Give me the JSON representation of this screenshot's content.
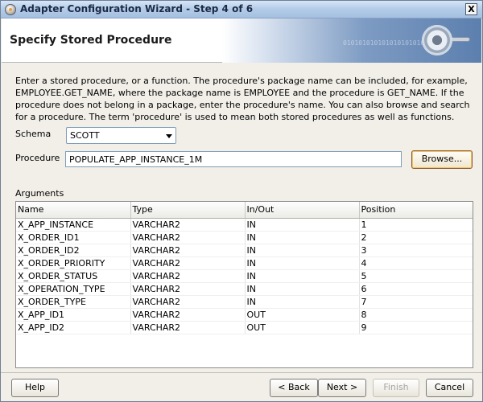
{
  "window": {
    "title": "Adapter Configuration Wizard - Step 4 of 6",
    "close_label": "X"
  },
  "header": {
    "title": "Specify Stored Procedure",
    "banner_bits": "010101010101010101010101"
  },
  "description": "Enter a stored procedure, or a function. The procedure's package name can be included, for example, EMPLOYEE.GET_NAME, where the package name is EMPLOYEE and the procedure is GET_NAME.  If the procedure does not belong in a package, enter the procedure's name. You can also browse and search for a procedure. The term 'procedure' is used to mean both stored procedures as well as functions.",
  "form": {
    "schema_label": "Schema",
    "schema_value": "SCOTT",
    "procedure_label": "Procedure",
    "procedure_value": "POPULATE_APP_INSTANCE_1M",
    "browse_label": "Browse..."
  },
  "arguments": {
    "label": "Arguments",
    "columns": [
      "Name",
      "Type",
      "In/Out",
      "Position"
    ],
    "rows": [
      [
        "X_APP_INSTANCE",
        "VARCHAR2",
        "IN",
        "1"
      ],
      [
        "X_ORDER_ID1",
        "VARCHAR2",
        "IN",
        "2"
      ],
      [
        "X_ORDER_ID2",
        "VARCHAR2",
        "IN",
        "3"
      ],
      [
        "X_ORDER_PRIORITY",
        "VARCHAR2",
        "IN",
        "4"
      ],
      [
        "X_ORDER_STATUS",
        "VARCHAR2",
        "IN",
        "5"
      ],
      [
        "X_OPERATION_TYPE",
        "VARCHAR2",
        "IN",
        "6"
      ],
      [
        "X_ORDER_TYPE",
        "VARCHAR2",
        "IN",
        "7"
      ],
      [
        "X_APP_ID1",
        "VARCHAR2",
        "OUT",
        "8"
      ],
      [
        "X_APP_ID2",
        "VARCHAR2",
        "OUT",
        "9"
      ]
    ]
  },
  "buttons": {
    "help": "Help",
    "back": "< Back",
    "next": "Next >",
    "finish": "Finish",
    "cancel": "Cancel"
  }
}
